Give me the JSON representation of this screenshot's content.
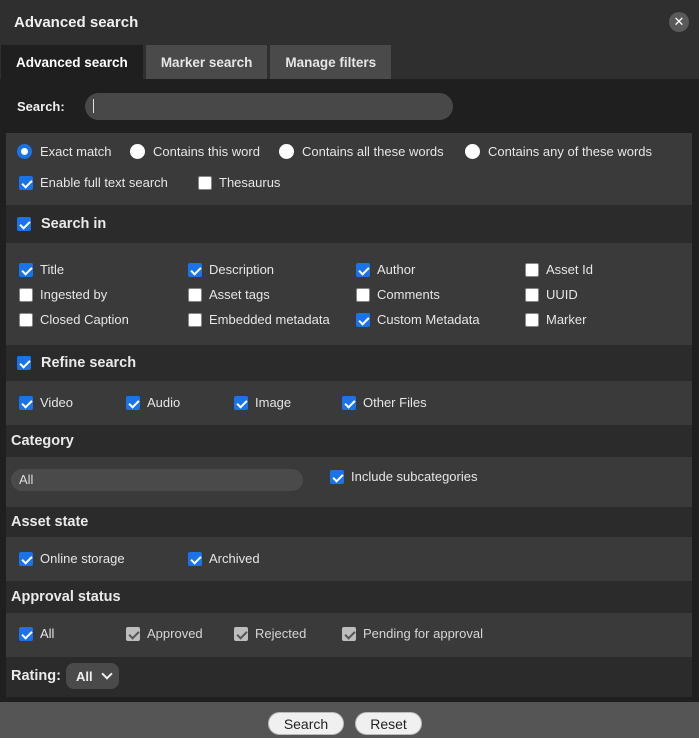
{
  "dialog": {
    "title": "Advanced search"
  },
  "tabs": [
    {
      "label": "Advanced search"
    },
    {
      "label": "Marker search"
    },
    {
      "label": "Manage filters"
    }
  ],
  "search": {
    "label": "Search:",
    "value": ""
  },
  "match_options": [
    {
      "label": "Exact match",
      "selected": true
    },
    {
      "label": "Contains this word",
      "selected": false
    },
    {
      "label": "Contains all these words",
      "selected": false
    },
    {
      "label": "Contains any of these words",
      "selected": false
    }
  ],
  "full_text": {
    "label": "Enable full text search",
    "checked": true
  },
  "thesaurus": {
    "label": "Thesaurus",
    "checked": false
  },
  "search_in": {
    "title": "Search in",
    "checked": true,
    "fields": [
      {
        "label": "Title",
        "checked": true
      },
      {
        "label": "Description",
        "checked": true
      },
      {
        "label": "Author",
        "checked": true
      },
      {
        "label": "Asset Id",
        "checked": false
      },
      {
        "label": "Ingested by",
        "checked": false
      },
      {
        "label": "Asset tags",
        "checked": false
      },
      {
        "label": "Comments",
        "checked": false
      },
      {
        "label": "UUID",
        "checked": false
      },
      {
        "label": "Closed Caption",
        "checked": false
      },
      {
        "label": "Embedded metadata",
        "checked": false
      },
      {
        "label": "Custom Metadata",
        "checked": true
      },
      {
        "label": "Marker",
        "checked": false
      }
    ]
  },
  "refine": {
    "title": "Refine search",
    "checked": true,
    "types": [
      {
        "label": "Video",
        "checked": true
      },
      {
        "label": "Audio",
        "checked": true
      },
      {
        "label": "Image",
        "checked": true
      },
      {
        "label": "Other Files",
        "checked": true
      }
    ]
  },
  "category": {
    "title": "Category",
    "value": "All",
    "include_label": "Include subcategories",
    "include_checked": true
  },
  "asset_state": {
    "title": "Asset state",
    "options": [
      {
        "label": "Online storage",
        "checked": true
      },
      {
        "label": "Archived",
        "checked": true
      }
    ]
  },
  "approval": {
    "title": "Approval status",
    "options": [
      {
        "label": "All",
        "checked": true
      },
      {
        "label": "Approved",
        "checked": true,
        "disabled": true
      },
      {
        "label": "Rejected",
        "checked": true,
        "disabled": true
      },
      {
        "label": "Pending for approval",
        "checked": true,
        "disabled": true
      }
    ]
  },
  "rating": {
    "label": "Rating:",
    "value": "All"
  },
  "buttons": {
    "search": "Search",
    "reset": "Reset"
  },
  "colors": {
    "accent": "#1a73e8",
    "panel": "#3a3a3a",
    "footer": "#555555"
  }
}
